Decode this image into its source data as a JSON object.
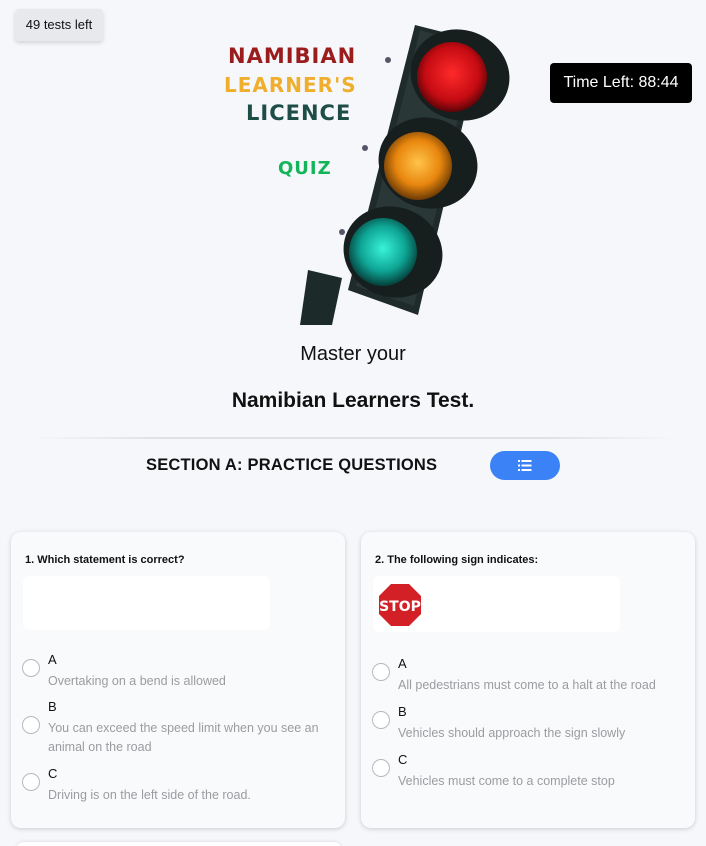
{
  "tests_left": "49 tests left",
  "timer": "Time Left: 88:44",
  "logo": {
    "line1": "NAMIBIAN",
    "line2": "LEARNER'S",
    "line3": "LICENCE",
    "line4": "QUIZ",
    "colors": {
      "line1": "#9b1c1c",
      "line2": "#efae2c",
      "line3": "#1e4d47",
      "line4": "#12b55a"
    }
  },
  "tagline": {
    "line1": "Master your",
    "line2": "Namibian Learners Test."
  },
  "section": {
    "title": "SECTION A: PRACTICE QUESTIONS",
    "list_button_icon": "list-icon",
    "accent": "#3b82f6"
  },
  "questions": [
    {
      "title": "1. Which statement is correct?",
      "options": [
        {
          "letter": "A",
          "text": "Overtaking on a bend is allowed"
        },
        {
          "letter": "B",
          "text": "You can exceed the speed limit when you see an animal on the road"
        },
        {
          "letter": "C",
          "text": "Driving is on the left side of the road."
        }
      ]
    },
    {
      "title": "2. The following sign indicates:",
      "sign": "STOP",
      "options": [
        {
          "letter": "A",
          "text": "All pedestrians must come to a halt at the road"
        },
        {
          "letter": "B",
          "text": "Vehicles should approach the sign slowly"
        },
        {
          "letter": "C",
          "text": "Vehicles must come to a complete stop"
        }
      ]
    }
  ]
}
